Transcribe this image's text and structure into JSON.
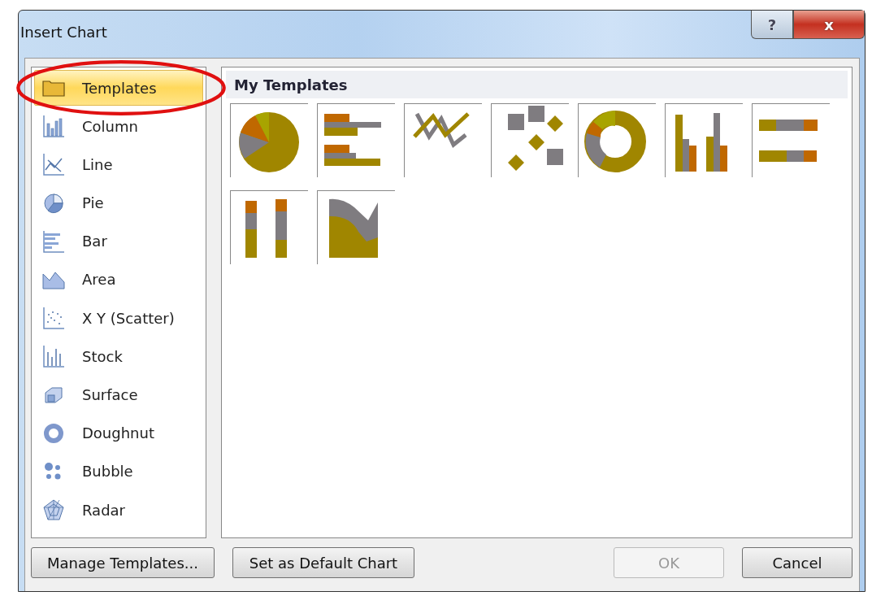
{
  "window": {
    "title": "Insert Chart",
    "help_button": "?",
    "close_button": "x"
  },
  "sidebar": {
    "items": [
      {
        "label": "Templates",
        "kind": "folder",
        "selected": true,
        "circled": true
      },
      {
        "label": "Column",
        "kind": "column",
        "selected": false,
        "circled": false
      },
      {
        "label": "Line",
        "kind": "line",
        "selected": false,
        "circled": false
      },
      {
        "label": "Pie",
        "kind": "pie",
        "selected": false,
        "circled": false
      },
      {
        "label": "Bar",
        "kind": "bar",
        "selected": false,
        "circled": false
      },
      {
        "label": "Area",
        "kind": "area",
        "selected": false,
        "circled": false
      },
      {
        "label": "X Y (Scatter)",
        "kind": "scatter",
        "selected": false,
        "circled": false
      },
      {
        "label": "Stock",
        "kind": "stock",
        "selected": false,
        "circled": false
      },
      {
        "label": "Surface",
        "kind": "surface",
        "selected": false,
        "circled": false
      },
      {
        "label": "Doughnut",
        "kind": "doughnut",
        "selected": false,
        "circled": false
      },
      {
        "label": "Bubble",
        "kind": "bubble",
        "selected": false,
        "circled": false
      },
      {
        "label": "Radar",
        "kind": "radar",
        "selected": false,
        "circled": false
      }
    ]
  },
  "templates": {
    "heading": "My Templates",
    "items": [
      {
        "kind": "pie"
      },
      {
        "kind": "bar"
      },
      {
        "kind": "line"
      },
      {
        "kind": "scatter"
      },
      {
        "kind": "doughnut"
      },
      {
        "kind": "column"
      },
      {
        "kind": "stackedbar"
      },
      {
        "kind": "stackedcolumn"
      },
      {
        "kind": "area"
      }
    ]
  },
  "buttons": [
    {
      "label": "Manage Templates...",
      "disabled": false
    },
    {
      "label": "Set as Default Chart",
      "disabled": false
    },
    {
      "label": "OK",
      "disabled": true
    },
    {
      "label": "Cancel",
      "disabled": false
    }
  ]
}
